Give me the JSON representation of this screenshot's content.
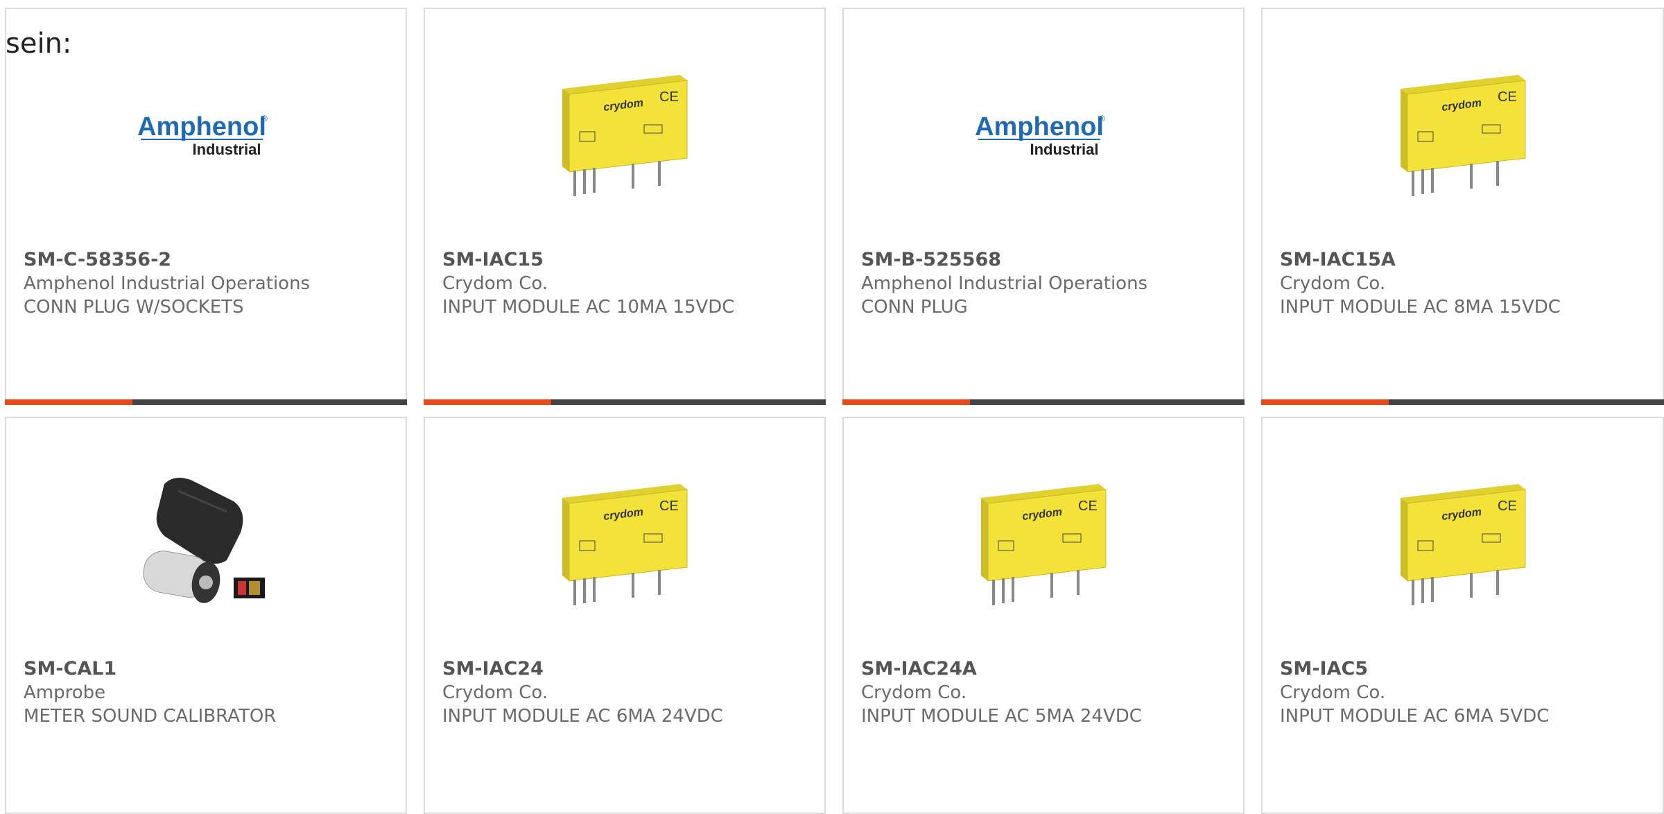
{
  "intro": "sein:",
  "colors": {
    "accent": "#e64a19",
    "bar": "#444444"
  },
  "products": [
    {
      "part": "SM-C-58356-2",
      "manufacturer": "Amphenol Industrial Operations",
      "description": "CONN PLUG W/SOCKETS",
      "image": "amphenol-logo",
      "logo_line1": "Amphenol",
      "logo_line2": "Industrial"
    },
    {
      "part": "SM-IAC15",
      "manufacturer": "Crydom Co.",
      "description": "INPUT MODULE AC 10MA 15VDC",
      "image": "crydom-module"
    },
    {
      "part": "SM-B-525568",
      "manufacturer": "Amphenol Industrial Operations",
      "description": "CONN PLUG",
      "image": "amphenol-logo",
      "logo_line1": "Amphenol",
      "logo_line2": "Industrial"
    },
    {
      "part": "SM-IAC15A",
      "manufacturer": "Crydom Co.",
      "description": "INPUT MODULE AC 8MA 15VDC",
      "image": "crydom-module"
    },
    {
      "part": "SM-CAL1",
      "manufacturer": "Amprobe",
      "description": "METER SOUND CALIBRATOR",
      "image": "sound-calibrator"
    },
    {
      "part": "SM-IAC24",
      "manufacturer": "Crydom Co.",
      "description": "INPUT MODULE AC 6MA 24VDC",
      "image": "crydom-module"
    },
    {
      "part": "SM-IAC24A",
      "manufacturer": "Crydom Co.",
      "description": "INPUT MODULE AC 5MA 24VDC",
      "image": "crydom-module"
    },
    {
      "part": "SM-IAC5",
      "manufacturer": "Crydom Co.",
      "description": "INPUT MODULE AC 6MA 5VDC",
      "image": "crydom-module"
    }
  ]
}
